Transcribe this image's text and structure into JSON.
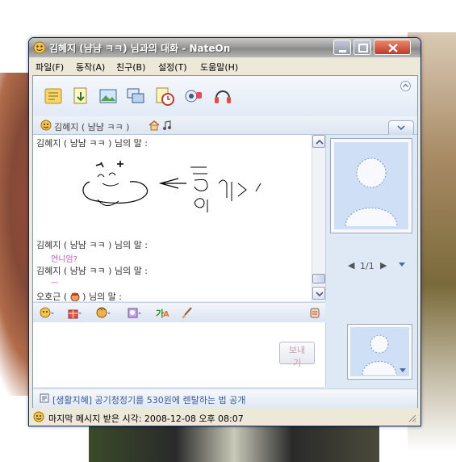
{
  "window": {
    "title": "김혜지 (냠냠 ㅋㅋ) 님과의 대화 - NateOn"
  },
  "menu": [
    {
      "label": "파일(F)"
    },
    {
      "label": "동작(A)"
    },
    {
      "label": "친구(B)"
    },
    {
      "label": "설정(T)"
    },
    {
      "label": "도움말(H)"
    }
  ],
  "toolbar": {
    "icons": [
      "memo-icon",
      "file-transfer-icon",
      "photo-icon",
      "screen-share-icon",
      "alarm-icon",
      "cam-icon",
      "headset-icon"
    ]
  },
  "contact": {
    "name": "김혜지 ( 냠냠 ㅋㅋ )"
  },
  "chat": {
    "lines": [
      {
        "speaker": "김혜지 ( 냠냠 ㅋㅋ ) 님의 말 :"
      },
      {
        "speaker": "김혜지 ( 냠냠 ㅋㅋ ) 님의 말 :",
        "message": "언니엄?"
      },
      {
        "speaker": "김혜지 ( 냠냠 ㅋㅋ ) 님의 말 :",
        "message": "ㅡ"
      },
      {
        "speaker": "오호근 (",
        "suffix": ") 님의 말 :"
      }
    ]
  },
  "avatar": {
    "page": "1/1"
  },
  "input": {
    "send_label": "보내기"
  },
  "news": {
    "text": "[생활지혜] 공기청정기를 530원에 렌탈하는 법 공개"
  },
  "status": {
    "text": "마지막 메시지 받은 시각: 2008-12-08 오후 08:07"
  },
  "colors": {
    "accent": "#3a5a9a",
    "pink": "#d64fc4"
  }
}
